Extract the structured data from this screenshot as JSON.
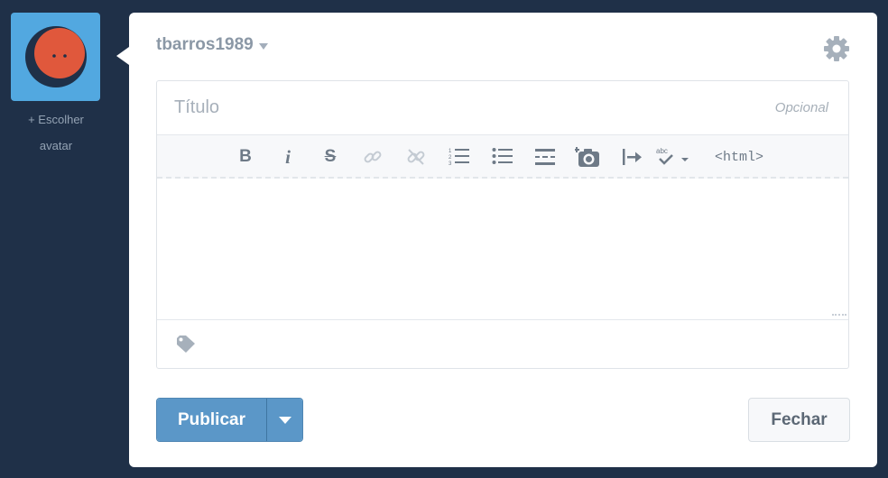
{
  "avatar": {
    "choose_label": "+ Escolher avatar",
    "colors": {
      "tile": "#52a8e0",
      "face": "#e0583c",
      "outline": "#1f3048"
    }
  },
  "blog": {
    "name": "tbarros1989"
  },
  "editor": {
    "title_placeholder": "Título",
    "title_hint": "Opcional",
    "toolbar": [
      {
        "name": "bold",
        "label": "B",
        "enabled": true
      },
      {
        "name": "italic",
        "label": "i",
        "enabled": true
      },
      {
        "name": "strikethrough",
        "label": "S",
        "enabled": true
      },
      {
        "name": "link",
        "icon": "link-icon",
        "enabled": false
      },
      {
        "name": "unlink",
        "icon": "unlink-icon",
        "enabled": false
      },
      {
        "name": "ordered-list",
        "icon": "ordered-list-icon",
        "enabled": true
      },
      {
        "name": "unordered-list",
        "icon": "unordered-list-icon",
        "enabled": true
      },
      {
        "name": "read-more",
        "icon": "read-more-break-icon",
        "enabled": true
      },
      {
        "name": "insert-image",
        "icon": "camera-plus-icon",
        "enabled": true
      },
      {
        "name": "indent",
        "icon": "indent-arrow-icon",
        "enabled": true
      },
      {
        "name": "spellcheck",
        "label": "abc",
        "icon": "spellcheck-icon",
        "enabled": true
      },
      {
        "name": "html",
        "label": "<html>",
        "enabled": true
      }
    ]
  },
  "footer": {
    "publish_label": "Publicar",
    "close_label": "Fechar"
  }
}
